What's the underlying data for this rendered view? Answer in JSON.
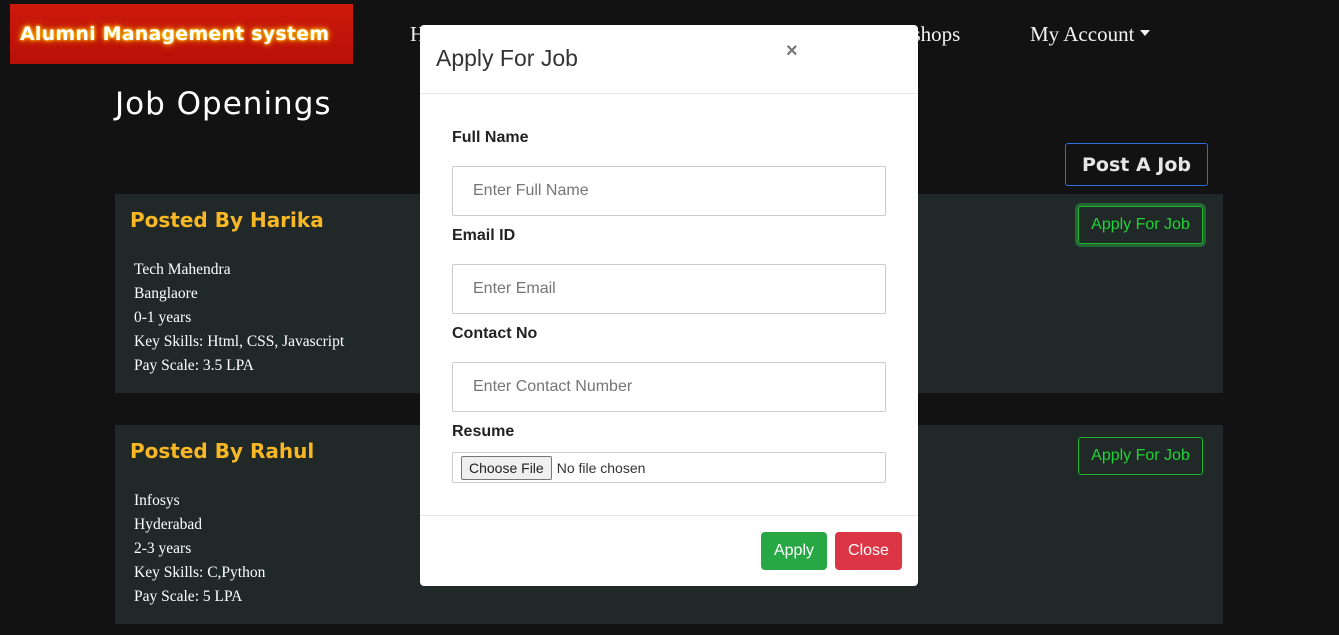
{
  "navbar": {
    "brand": "Alumni Management system",
    "home_fragment": "H",
    "workshops_fragment": "kshops",
    "my_account": "My Account"
  },
  "page": {
    "title": "Job Openings",
    "post_job_label": "Post A Job"
  },
  "jobs": [
    {
      "posted_by": "Posted By Harika",
      "company": "Tech Mahendra",
      "location": "Banglaore",
      "experience": "0-1 years",
      "skills": "Key Skills: Html, CSS, Javascript",
      "pay": "Pay Scale: 3.5 LPA",
      "apply_label": "Apply For Job"
    },
    {
      "posted_by": "Posted By Rahul",
      "company": "Infosys",
      "location": "Hyderabad",
      "experience": "2-3 years",
      "skills": "Key Skills: C,Python",
      "pay": "Pay Scale: 5 LPA",
      "apply_label": "Apply For Job"
    }
  ],
  "modal": {
    "title": "Apply For Job",
    "close_symbol": "×",
    "full_name_label": "Full Name",
    "full_name_placeholder": "Enter Full Name",
    "email_label": "Email ID",
    "email_placeholder": "Enter Email",
    "contact_label": "Contact No",
    "contact_placeholder": "Enter Contact Number",
    "resume_label": "Resume",
    "choose_file_label": "Choose File",
    "file_status": "No file chosen",
    "apply_button": "Apply",
    "close_button": "Close"
  },
  "colors": {
    "background": "#131212",
    "card": "#202828",
    "accent_yellow": "#f8b724",
    "apply_green": "#28a745",
    "close_red": "#dc3545",
    "brand_red": "#cc1a0c"
  }
}
